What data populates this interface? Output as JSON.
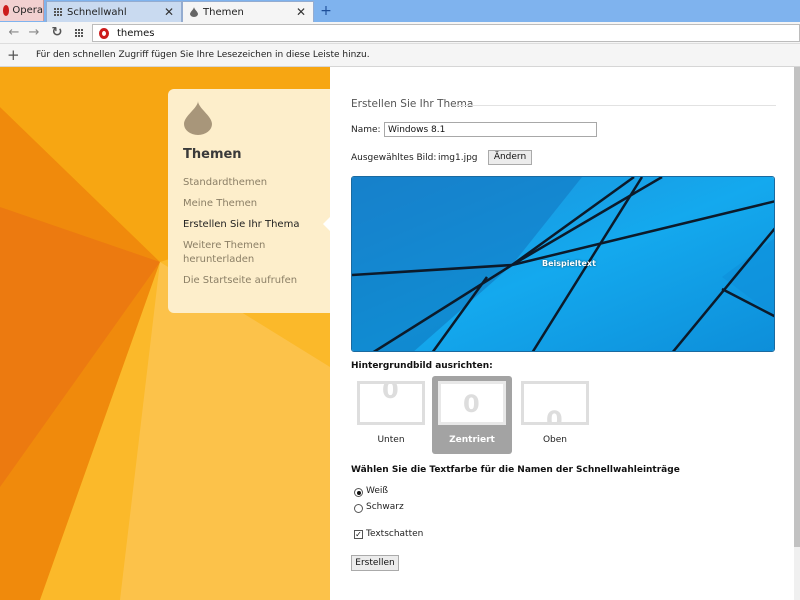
{
  "browser": {
    "menu_label": "Opera",
    "tabs": [
      {
        "label": "Schnellwahl",
        "active": false
      },
      {
        "label": "Themen",
        "active": true
      }
    ],
    "new_tab_label": "+",
    "address": "themes",
    "bookmarks_hint": "Für den schnellen Zugriff fügen Sie Ihre Lesezeichen in diese Leiste hinzu."
  },
  "sidebar": {
    "title": "Themen",
    "items": [
      {
        "label": "Standardthemen"
      },
      {
        "label": "Meine Themen"
      },
      {
        "label": "Erstellen Sie Ihr Thema",
        "current": true
      },
      {
        "label": "Weitere Themen herunterladen"
      },
      {
        "label": "Die Startseite aufrufen"
      }
    ]
  },
  "editor": {
    "heading": "Erstellen Sie Ihr Thema",
    "name_label": "Name:",
    "name_value": "Windows 8.1",
    "image_label": "Ausgewähltes Bild:",
    "image_file": "img1.jpg",
    "change_button": "Ändern",
    "preview_text": "Beispieltext",
    "align_heading": "Hintergrundbild ausrichten:",
    "align_options": [
      {
        "label": "Unten",
        "selected": false
      },
      {
        "label": "Zentriert",
        "selected": true
      },
      {
        "label": "Oben",
        "selected": false
      }
    ],
    "textcolor_heading": "Wählen Sie die Textfarbe für die Namen der Schnellwahleinträge",
    "textcolor_options": [
      {
        "label": "Weiß",
        "checked": true
      },
      {
        "label": "Schwarz",
        "checked": false
      }
    ],
    "shadow_label": "Textschatten",
    "shadow_checked": true,
    "create_button": "Erstellen"
  },
  "colors": {
    "background_orange": "#f5a10b",
    "sidebar_bg": "#fdeecb",
    "preview_blue": "#12a2ea",
    "tab_bar": "#7fb3ee",
    "opera_red": "#cc1b1b"
  }
}
